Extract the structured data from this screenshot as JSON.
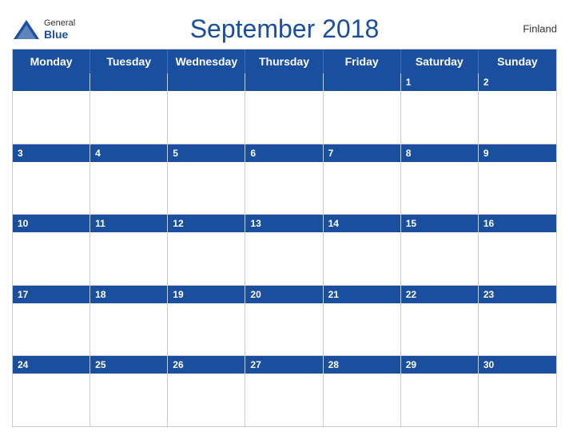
{
  "header": {
    "title": "September 2018",
    "country": "Finland",
    "logo": {
      "general": "General",
      "blue": "Blue"
    }
  },
  "days": {
    "headers": [
      "Monday",
      "Tuesday",
      "Wednesday",
      "Thursday",
      "Friday",
      "Saturday",
      "Sunday"
    ]
  },
  "weeks": [
    [
      null,
      null,
      null,
      null,
      null,
      1,
      2
    ],
    [
      3,
      4,
      5,
      6,
      7,
      8,
      9
    ],
    [
      10,
      11,
      12,
      13,
      14,
      15,
      16
    ],
    [
      17,
      18,
      19,
      20,
      21,
      22,
      23
    ],
    [
      24,
      25,
      26,
      27,
      28,
      29,
      30
    ]
  ]
}
